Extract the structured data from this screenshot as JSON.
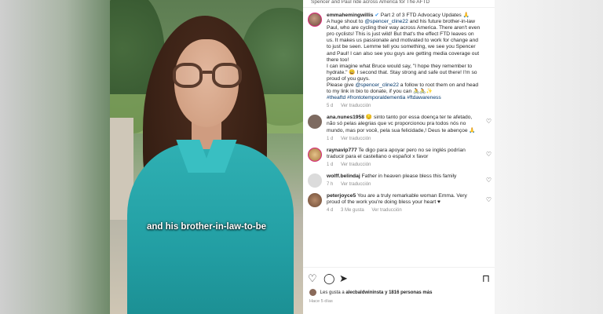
{
  "topbar": {
    "text": "Spencer and Paul ride across America for The AFTD"
  },
  "caption": {
    "text": "and his brother-in-law-to-be"
  },
  "post": {
    "username": "emmahemingwillis",
    "lines": [
      "Part 2 of 3 FTD Advocacy Updates",
      "A huge shout to",
      "@spencer_cline22",
      "and his future brother-in-law Paul, who are cycling their way across America. There aren't even pro cyclists! This is just wild! But that's the effect FTD leaves on us. It makes us passionate and motivated to work for change and to just be seen. Lemme tell you something, we see you Spencer and Paul! I can also see you guys are getting media coverage out there too!",
      "I can imagine what Bruce would say, \"I hope they remember to hydrate.\" 😄 I second that. Stay strong and safe out there! I'm so proud of you guys.",
      "Please give",
      "@spencer_cline22",
      "a follow to root them on and head to my link in bio to donate, if you can 🚴🚴✨",
      "#theaftd #frontotemporaldementia #ftdawareness"
    ],
    "time": "5 d",
    "translate": "Ver traducción"
  },
  "comments": [
    {
      "user": "ana.nunes1958",
      "text": "😔 sinto tanto por essa doença ter te afetado, não só pelas alegrias que vc proporcionou pra todos nós no mundo, mas por você, pela sua felicidade,! Deus te abençoe 🙏",
      "time": "1 d",
      "translate": "Ver traducción",
      "likes": ""
    },
    {
      "user": "raynavip777",
      "text": "Te digo para apoyar pero no se inglés podrían traducir para el castellano o español x favor",
      "time": "1 d",
      "translate": "Ver traducción",
      "likes": ""
    },
    {
      "user": "wolff.belindaj",
      "text": "Father in heaven please bless this family",
      "time": "7 h",
      "translate": "Ver traducción",
      "likes": ""
    },
    {
      "user": "peterjoyce5",
      "text": "You are a truly remarkable woman Emma. Very proud of the work you're doing bless your heart ♥",
      "time": "4 d",
      "translate": "Ver traducción",
      "likes": "3 Me gusta"
    }
  ],
  "footer": {
    "likes_prefix": "Les gusta a",
    "likes_user": "alecbaldwininsta",
    "likes_suffix": "y 1816 personas más",
    "ago": "Hace 5 días"
  },
  "icons": {
    "like": "heart-icon",
    "comment": "comment-icon",
    "share": "send-icon",
    "save": "bookmark-icon"
  },
  "colors": {
    "accent": "#00376b",
    "muted": "#8e8e8e",
    "text": "#262626",
    "shirt": "#2fb0b3"
  }
}
